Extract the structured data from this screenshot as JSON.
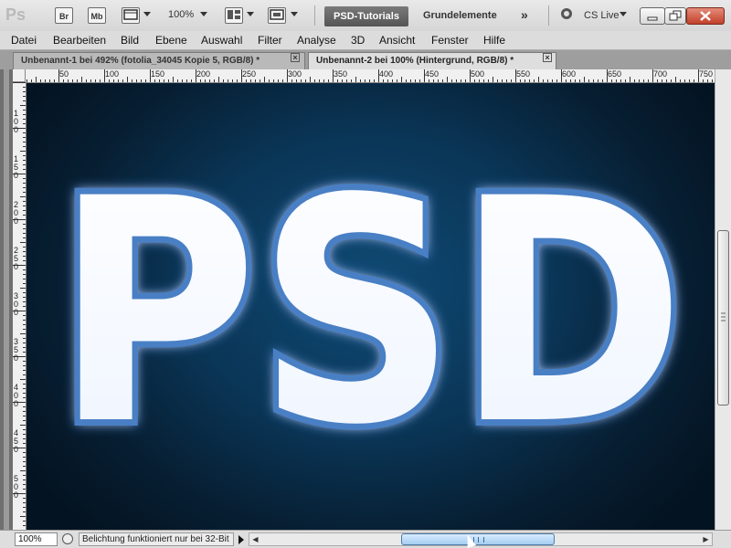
{
  "app": {
    "logo": "Ps",
    "toolbar": {
      "bridge_label": "Br",
      "minibridge_label": "Mb",
      "zoom": "100%",
      "workspace_active": "PSD-Tutorials",
      "workspace_other": "Grundelemente",
      "workspace_more": "»",
      "cs_live": "CS Live"
    }
  },
  "menu": [
    "Datei",
    "Bearbeiten",
    "Bild",
    "Ebene",
    "Auswahl",
    "Filter",
    "Analyse",
    "3D",
    "Ansicht",
    "Fenster",
    "Hilfe"
  ],
  "tabs": [
    {
      "label": "Unbenannt-1 bei 492% (fotolia_34045 Kopie 5, RGB/8) *",
      "active": false
    },
    {
      "label": "Unbenannt-2 bei 100% (Hintergrund, RGB/8) *",
      "active": true
    }
  ],
  "ruler": {
    "h_labels": [
      "50",
      "100",
      "150",
      "200",
      "250",
      "300",
      "350",
      "400",
      "450",
      "500",
      "550",
      "600",
      "650",
      "700",
      "750"
    ],
    "v_labels": [
      "100",
      "150",
      "200",
      "250",
      "300",
      "350",
      "400",
      "450",
      "500"
    ]
  },
  "canvas": {
    "text": "PSD",
    "bg_color": "#0b3a5e"
  },
  "status": {
    "zoom": "100%",
    "message": "Belichtung funktioniert nur bei 32-Bit"
  },
  "scroll": {
    "v_position": 0.45,
    "h_position": 0.33
  }
}
